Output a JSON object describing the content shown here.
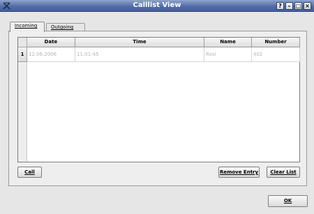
{
  "window": {
    "title": "Calllist View",
    "icon": "x-tools-icon",
    "buttons": [
      "?",
      "–",
      "□",
      "×"
    ]
  },
  "tabs": [
    {
      "label": "Incoming",
      "active": true
    },
    {
      "label": "Outgoing",
      "active": false
    }
  ],
  "table": {
    "columns": [
      "Date",
      "Time",
      "Name",
      "Number"
    ],
    "rows": [
      {
        "index": "1",
        "date": "12.06.2006",
        "time": "11:01:45",
        "name": "Rosi",
        "number": "402"
      }
    ]
  },
  "actions": {
    "call": "Call",
    "remove": "Remove Entry",
    "clear": "Clear List"
  },
  "footer": {
    "ok": "OK"
  }
}
